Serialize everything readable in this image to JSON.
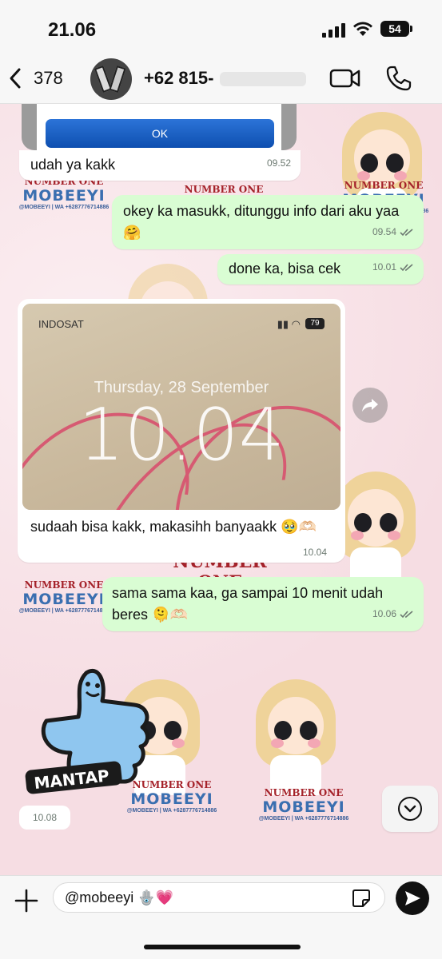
{
  "status_bar": {
    "time": "21.06",
    "battery": "54"
  },
  "header": {
    "back_count": "378",
    "contact_name": "+62 815-"
  },
  "messages": {
    "dialog_ok": "OK",
    "m1": {
      "text": "udah ya kakk",
      "time": "09.52",
      "dir": "in"
    },
    "m2": {
      "text": "okey ka masukk, ditunggu info dari aku yaa🤗",
      "time": "09.54",
      "dir": "out"
    },
    "m3": {
      "text": "done ka, bisa cek",
      "time": "10.01",
      "dir": "out"
    },
    "m4": {
      "image": {
        "carrier": "INDOSAT",
        "battery": "79",
        "date": "Thursday, 28 September",
        "lock_time": "10.04"
      },
      "text": "sudaah bisa kakk, makasihh banyaakk 🥹🫶🏻",
      "time": "10.04",
      "dir": "in"
    },
    "m5": {
      "text": "sama sama kaa, ga sampai 10 menit udah beres 🫠🫶🏻",
      "time": "10.06",
      "dir": "out"
    },
    "m6": {
      "sticker_text": "MANTAP",
      "time": "10.08",
      "dir": "in"
    }
  },
  "wallpaper": {
    "brand_line1": "NUMBER ONE",
    "brand_line2": "MOBEEYI",
    "brand_line3": "@MOBEEYI | WA +6287776714886"
  },
  "composer": {
    "text": "@mobeeyi 🪬💗"
  },
  "colors": {
    "incoming": "#ffffff",
    "outgoing": "#d9fdd3",
    "wallpaper": "#f7e3e8",
    "ticks": "#6d7a72"
  }
}
